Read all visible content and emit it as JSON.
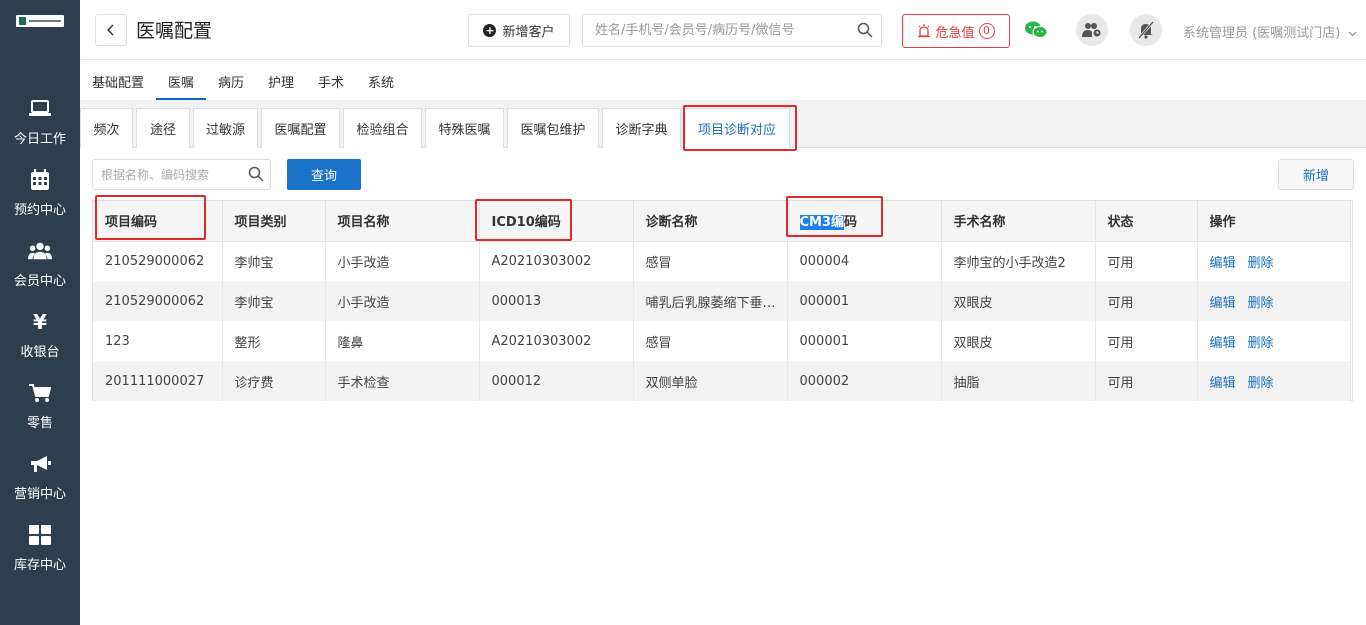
{
  "sidebar": {
    "items": [
      {
        "label": "今日工作",
        "icon": "laptop-icon"
      },
      {
        "label": "预约中心",
        "icon": "calendar-icon"
      },
      {
        "label": "会员中心",
        "icon": "users-icon"
      },
      {
        "label": "收银台",
        "icon": "yen-icon"
      },
      {
        "label": "零售",
        "icon": "cart-icon"
      },
      {
        "label": "营销中心",
        "icon": "megaphone-icon"
      },
      {
        "label": "库存中心",
        "icon": "grid-icon"
      }
    ]
  },
  "header": {
    "title": "医嘱配置",
    "new_customer": "新增客户",
    "search_placeholder": "姓名/手机号/会员号/病历号/微信号",
    "danger_label": "危急值",
    "danger_count": "0",
    "user": "系统管理员 (医嘱测试门店)"
  },
  "top_tabs": [
    "基础配置",
    "医嘱",
    "病历",
    "护理",
    "手术",
    "系统"
  ],
  "sub_tabs": [
    "频次",
    "途径",
    "过敏源",
    "医嘱配置",
    "检验组合",
    "特殊医嘱",
    "医嘱包维护",
    "诊断字典",
    "项目诊断对应"
  ],
  "toolbar": {
    "search_placeholder": "根据名称、编码搜索",
    "query_label": "查询",
    "add_label": "新增"
  },
  "table": {
    "headers": [
      "项目编码",
      "项目类别",
      "项目名称",
      "ICD10编码",
      "诊断名称",
      "CM3编码",
      "手术名称",
      "状态",
      "操作"
    ],
    "cm3_highlight": "CM3编",
    "cm3_rest": "码",
    "rows": [
      [
        "210529000062",
        "李帅宝",
        "小手改造",
        "A20210303002",
        "感冒",
        "000004",
        "李帅宝的小手改造2",
        "可用"
      ],
      [
        "210529000062",
        "李帅宝",
        "小手改造",
        "000013",
        "哺乳后乳腺萎缩下垂…",
        "000001",
        "双眼皮",
        "可用"
      ],
      [
        "123",
        "整形",
        "隆鼻",
        "A20210303002",
        "感冒",
        "000001",
        "双眼皮",
        "可用"
      ],
      [
        "201111000027",
        "诊疗费",
        "手术检查",
        "000012",
        "双侧单脸",
        "000002",
        "抽脂",
        "可用"
      ]
    ],
    "edit_label": "编辑",
    "delete_label": "删除"
  },
  "colors": {
    "sidebar_bg": "#2f3e4d",
    "primary": "#1a73c9",
    "danger": "#e5404a",
    "annotation": "#e5282a"
  }
}
